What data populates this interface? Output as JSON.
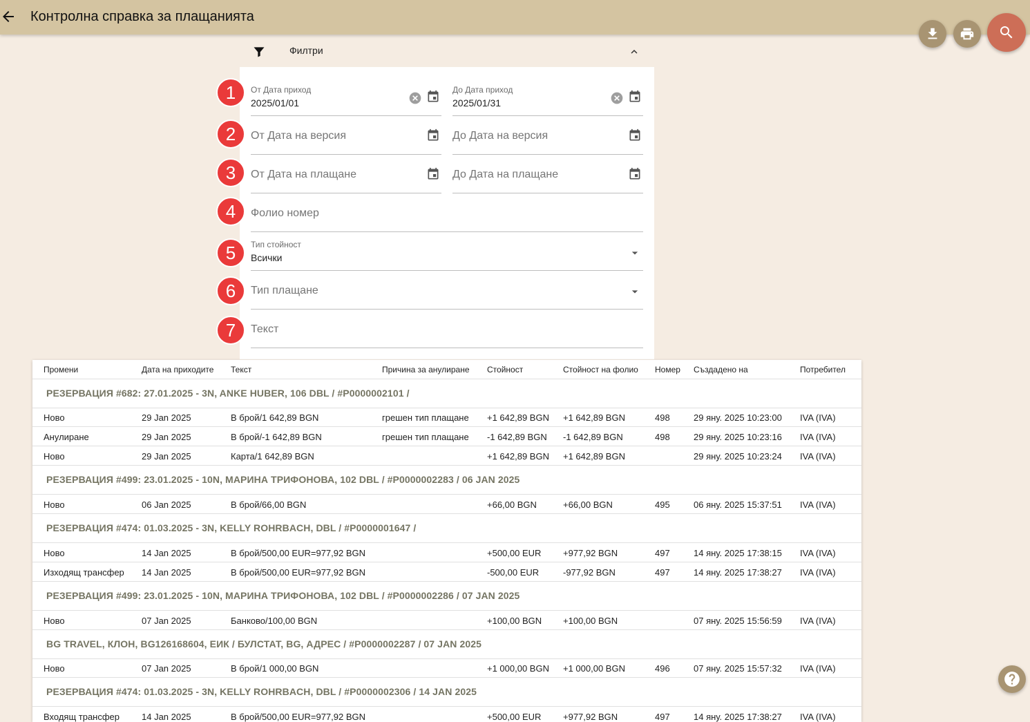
{
  "header": {
    "title": "Контролна справка за плащанията"
  },
  "filters": {
    "label": "Филтри",
    "date_income_from": {
      "label": "От Дата приход",
      "value": "2025/01/01"
    },
    "date_income_to": {
      "label": "До Дата приход",
      "value": "2025/01/31"
    },
    "version_from": {
      "placeholder": "От Дата на версия"
    },
    "version_to": {
      "placeholder": "До Дата на версия"
    },
    "payment_from": {
      "placeholder": "От Дата на плащане"
    },
    "payment_to": {
      "placeholder": "До Дата на плащане"
    },
    "folio": {
      "placeholder": "Фолио номер"
    },
    "value_type": {
      "label": "Тип стойност",
      "value": "Всички"
    },
    "payment_type": {
      "placeholder": "Тип плащане"
    },
    "text": {
      "placeholder": "Текст"
    }
  },
  "steps": [
    "1",
    "2",
    "3",
    "4",
    "5",
    "6",
    "7"
  ],
  "table": {
    "columns": [
      "Промени",
      "Дата на приходите",
      "Текст",
      "Причина за анулиране",
      "Стойност",
      "Стойност на фолио",
      "Номер",
      "Създадено на",
      "Потребител"
    ],
    "groups": [
      {
        "title": "РЕЗЕРВАЦИЯ #682: 27.01.2025 - 3N, ANKE HUBER, 106 DBL / #P0000002101 /",
        "rows": [
          [
            "Ново",
            "29 Jan 2025",
            "В брой/1 642,89 BGN",
            "грешен тип плащане",
            "+1 642,89 BGN",
            "+1 642,89 BGN",
            "498",
            "29 яну. 2025 10:23:00",
            "IVA (IVA)"
          ],
          [
            "Анулиране",
            "29 Jan 2025",
            "В брой/-1 642,89 BGN",
            "грешен тип плащане",
            "-1 642,89 BGN",
            "-1 642,89 BGN",
            "498",
            "29 яну. 2025 10:23:16",
            "IVA (IVA)"
          ],
          [
            "Ново",
            "29 Jan 2025",
            "Карта/1 642,89 BGN",
            "",
            "+1 642,89 BGN",
            "+1 642,89 BGN",
            "",
            "29 яну. 2025 10:23:24",
            "IVA (IVA)"
          ]
        ]
      },
      {
        "title": "РЕЗЕРВАЦИЯ #499: 23.01.2025 - 10N, МАРИНА ТРИФОНОВА, 102 DBL / #P0000002283 / 06 JAN 2025",
        "rows": [
          [
            "Ново",
            "06 Jan 2025",
            "В брой/66,00 BGN",
            "",
            "+66,00 BGN",
            "+66,00 BGN",
            "495",
            "06 яну. 2025 15:37:51",
            "IVA (IVA)"
          ]
        ]
      },
      {
        "title": "РЕЗЕРВАЦИЯ #474: 01.03.2025 - 3N, KELLY ROHRBACH, DBL / #P0000001647 /",
        "rows": [
          [
            "Ново",
            "14 Jan 2025",
            "В брой/500,00 EUR=977,92 BGN",
            "",
            "+500,00 EUR",
            "+977,92 BGN",
            "497",
            "14 яну. 2025 17:38:15",
            "IVA (IVA)"
          ],
          [
            "Изходящ трансфер",
            "14 Jan 2025",
            "В брой/500,00 EUR=977,92 BGN",
            "",
            "-500,00 EUR",
            "-977,92 BGN",
            "497",
            "14 яну. 2025 17:38:27",
            "IVA (IVA)"
          ]
        ]
      },
      {
        "title": "РЕЗЕРВАЦИЯ #499: 23.01.2025 - 10N, МАРИНА ТРИФОНОВА, 102 DBL / #P0000002286 / 07 JAN 2025",
        "rows": [
          [
            "Ново",
            "07 Jan 2025",
            "Банково/100,00 BGN",
            "",
            "+100,00 BGN",
            "+100,00 BGN",
            "",
            "07 яну. 2025 15:56:59",
            "IVA (IVA)"
          ]
        ]
      },
      {
        "title": "BG TRAVEL, КЛОН, BG126168604, ЕИК / БУЛСТАТ, BG, АДРЕС / #P0000002287 / 07 JAN 2025",
        "rows": [
          [
            "Ново",
            "07 Jan 2025",
            "В брой/1 000,00 BGN",
            "",
            "+1 000,00 BGN",
            "+1 000,00 BGN",
            "496",
            "07 яну. 2025 15:57:32",
            "IVA (IVA)"
          ]
        ]
      },
      {
        "title": "РЕЗЕРВАЦИЯ #474: 01.03.2025 - 3N, KELLY ROHRBACH, DBL / #P0000002306 / 14 JAN 2025",
        "rows": [
          [
            "Входящ трансфер",
            "14 Jan 2025",
            "В брой/500,00 EUR=977,92 BGN",
            "",
            "+500,00 EUR",
            "+977,92 BGN",
            "497",
            "14 яну. 2025 17:38:27",
            "IVA (IVA)"
          ]
        ]
      }
    ]
  }
}
